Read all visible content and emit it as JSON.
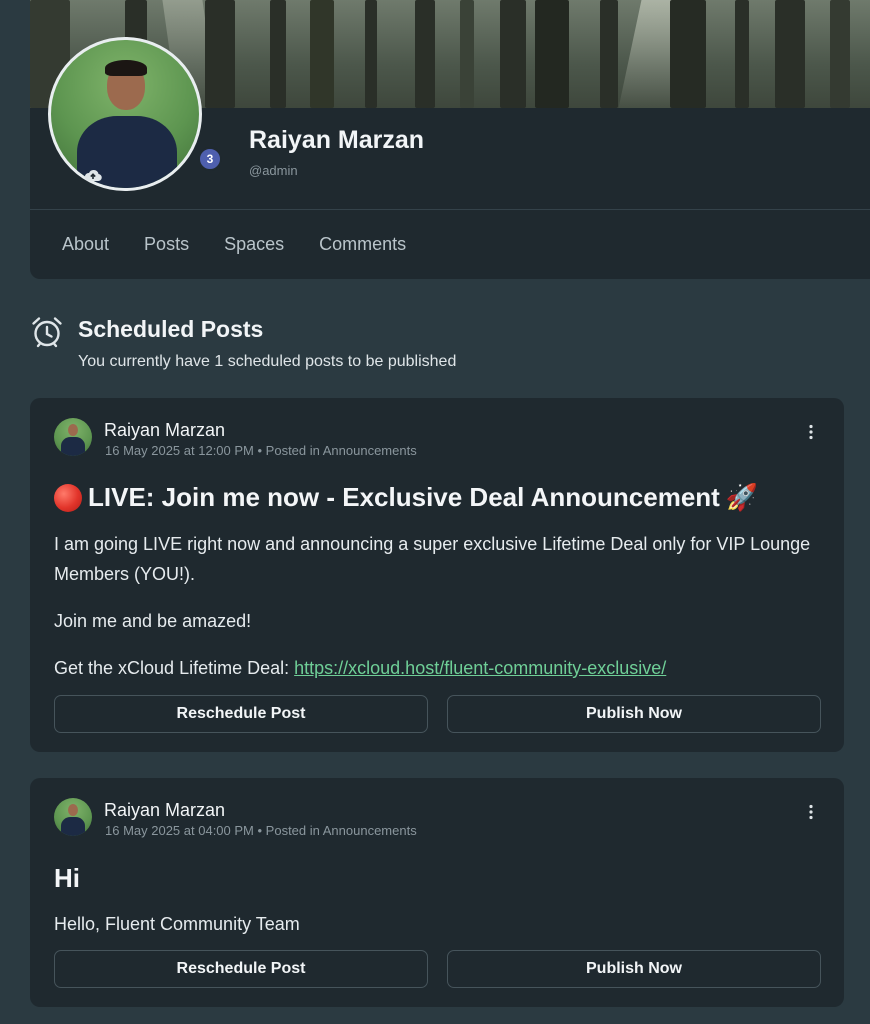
{
  "profile": {
    "name": "Raiyan Marzan",
    "handle": "@admin",
    "badge_count": "3",
    "tabs": [
      "About",
      "Posts",
      "Spaces",
      "Comments"
    ]
  },
  "scheduled": {
    "title": "Scheduled Posts",
    "subtitle": "You currently have 1 scheduled posts to be published"
  },
  "posts": [
    {
      "author": "Raiyan Marzan",
      "date": "16 May 2025 at 12:00 PM",
      "posted_in": "• Posted in Announcements",
      "title": "LIVE: Join me now - Exclusive Deal Announcement",
      "title_emoji": "🚀",
      "paragraphs": [
        "I am going LIVE right now and announcing a super exclusive Lifetime Deal only for VIP Lounge Members (YOU!).",
        "Join me and be amazed!"
      ],
      "link_prefix": "Get the xCloud Lifetime Deal: ",
      "link_text": "https://xcloud.host/fluent-community-exclusive/",
      "reschedule_label": "Reschedule Post",
      "publish_label": "Publish Now"
    },
    {
      "author": "Raiyan Marzan",
      "date": "16 May 2025 at 04:00 PM",
      "posted_in": "• Posted in Announcements",
      "title": "Hi",
      "paragraphs": [
        "Hello, Fluent Community Team"
      ],
      "reschedule_label": "Reschedule Post",
      "publish_label": "Publish Now"
    }
  ],
  "icons": {
    "upload": "cloud-upload-icon",
    "schedule": "alarm-clock-icon",
    "more": "more-vertical-icon",
    "live": "red-circle-icon"
  },
  "colors": {
    "page_bg": "#2b3a41",
    "card_bg": "#1f292f",
    "link": "#6fcf97",
    "badge": "#4e5fae"
  }
}
